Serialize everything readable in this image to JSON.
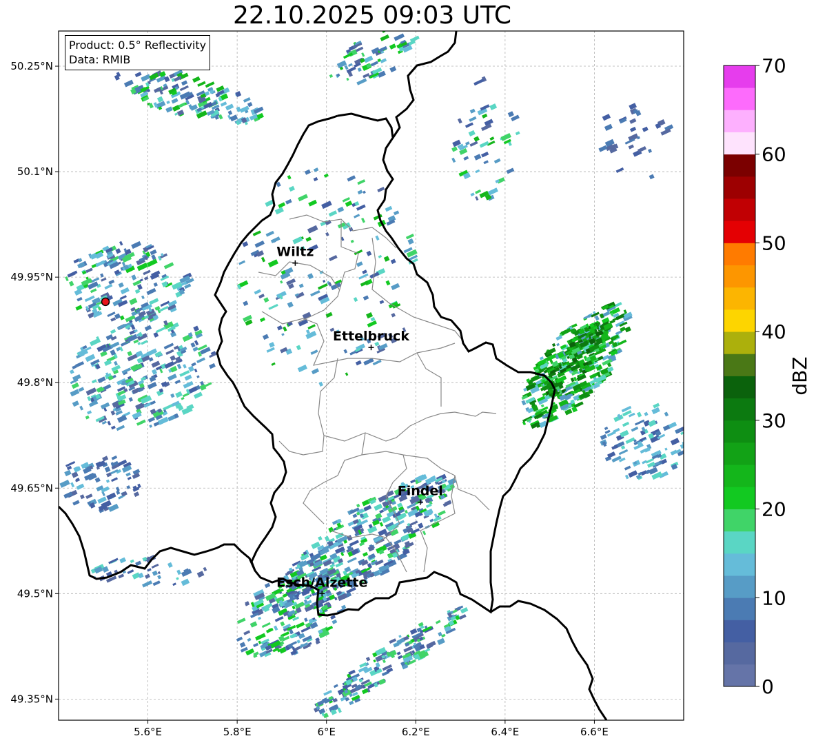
{
  "map": {
    "title": "22.10.2025 09:03 UTC",
    "info": {
      "product": "Product: 0.5° Reflectivity",
      "data": "Data: RMIB"
    },
    "extent": {
      "lon_min": 5.4,
      "lon_max": 6.8,
      "lat_min": 49.32,
      "lat_max": 50.3
    },
    "lat_ticks": [
      {
        "value": 50.25,
        "label": "50.25°N"
      },
      {
        "value": 50.1,
        "label": "50.1°N"
      },
      {
        "value": 49.95,
        "label": "49.95°N"
      },
      {
        "value": 49.8,
        "label": "49.8°N"
      },
      {
        "value": 49.65,
        "label": "49.65°N"
      },
      {
        "value": 49.5,
        "label": "49.5°N"
      },
      {
        "value": 49.35,
        "label": "49.35°N"
      }
    ],
    "lon_ticks": [
      {
        "value": 5.6,
        "label": "5.6°E"
      },
      {
        "value": 5.8,
        "label": "5.8°E"
      },
      {
        "value": 6.0,
        "label": "6°E"
      },
      {
        "value": 6.2,
        "label": "6.2°E"
      },
      {
        "value": 6.4,
        "label": "6.4°E"
      },
      {
        "value": 6.6,
        "label": "6.6°E"
      }
    ],
    "cities": [
      {
        "name": "Wiltz",
        "lon": 5.93,
        "lat": 49.97
      },
      {
        "name": "Ettelbruck",
        "lon": 6.1,
        "lat": 49.85
      },
      {
        "name": "Findel",
        "lon": 6.21,
        "lat": 49.63
      },
      {
        "name": "Esch/Alzette",
        "lon": 5.99,
        "lat": 49.5
      }
    ],
    "radar_site": {
      "lon": 5.505,
      "lat": 49.915,
      "color": "#e8141a"
    },
    "border_color": "#000000",
    "canton_color": "#888888",
    "grid_color": "#b0b0b0"
  },
  "colorbar": {
    "label": "dBZ",
    "min": 0,
    "max": 70,
    "tick_values": [
      0,
      10,
      20,
      30,
      40,
      50,
      60,
      70
    ],
    "colors": [
      "#6574a8",
      "#5669a0",
      "#445fa3",
      "#4b7bb3",
      "#579cc6",
      "#65bcd9",
      "#5ad6c4",
      "#40d468",
      "#12c921",
      "#14b61b",
      "#12a216",
      "#0e8e12",
      "#0c7a10",
      "#0b620c",
      "#4a7816",
      "#acb00c",
      "#fdd500",
      "#fcb501",
      "#fd9600",
      "#ff7b00",
      "#e40003",
      "#c10003",
      "#9d0001",
      "#7b0000",
      "#fee3fd",
      "#fdb0fe",
      "#fd6bfc",
      "#e63ded"
    ]
  }
}
